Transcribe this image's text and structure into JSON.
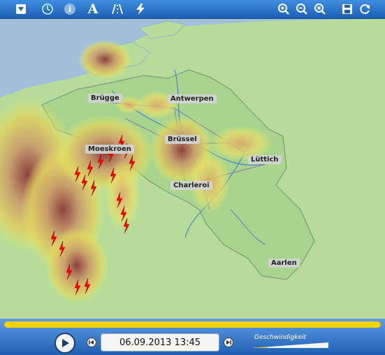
{
  "toolbar": {
    "left_icons": [
      "dropdown-icon",
      "history-icon",
      "info-icon",
      "text-icon",
      "road-icon",
      "lightning-icon"
    ],
    "right_icons": [
      "zoom-in-icon",
      "zoom-out-icon",
      "zoom-reset-icon",
      "save-icon",
      "refresh-icon"
    ],
    "text_button_label": "A"
  },
  "map": {
    "cities": [
      "Brügge",
      "Antwerpen",
      "Brüssel",
      "Moeskroen",
      "Lüttich",
      "Charleroi",
      "Aarlen"
    ]
  },
  "playback": {
    "progress": 1.0,
    "timestamp": "06.09.2013 13:45",
    "speed_label": "Geschwindigkeit",
    "speed_level": 0.2
  },
  "colors": {
    "toolbar": "#2f76cf",
    "progress": "#f2d200",
    "land": "#b7dc9a",
    "belgium": "#a9d48e",
    "sea": "#9fc0d8",
    "lightning": "#ff0000"
  }
}
